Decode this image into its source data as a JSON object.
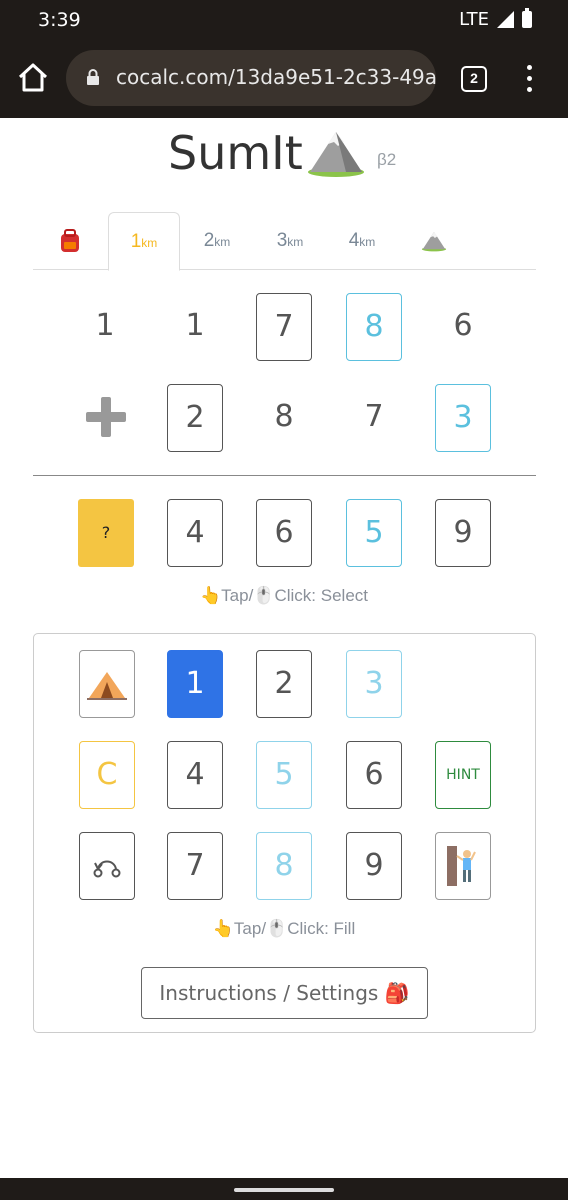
{
  "status": {
    "time": "3:39",
    "network": "LTE"
  },
  "browser": {
    "url": "cocalc.com/13da9e51-2c33-49a",
    "tab_count": "2"
  },
  "app": {
    "title": "SumIt",
    "beta": "β2"
  },
  "tabs": [
    {
      "label": "",
      "icon": "backpack-icon"
    },
    {
      "label": "1",
      "unit": "km",
      "active": true
    },
    {
      "label": "2",
      "unit": "km"
    },
    {
      "label": "3",
      "unit": "km"
    },
    {
      "label": "4",
      "unit": "km"
    },
    {
      "label": "",
      "icon": "mountain-icon"
    }
  ],
  "puzzle": {
    "row1": [
      "1",
      "1",
      "7",
      "8",
      "6"
    ],
    "row2": [
      "2",
      "8",
      "7",
      "3"
    ],
    "result": [
      "?",
      "4",
      "6",
      "5",
      "9"
    ],
    "select_hint": "👆Tap/🖱️Click: Select"
  },
  "keypad": {
    "keys": [
      "1",
      "2",
      "3",
      "C",
      "4",
      "5",
      "6",
      "HINT",
      "7",
      "8",
      "9"
    ],
    "fill_hint": "👆Tap/🖱️Click: Fill",
    "settings_label": "Instructions / Settings 🎒"
  },
  "colors": {
    "accent_blue": "#2f73e6",
    "cyan": "#5bc0de",
    "yellow": "#f4c542",
    "green": "#2e8b3e"
  }
}
